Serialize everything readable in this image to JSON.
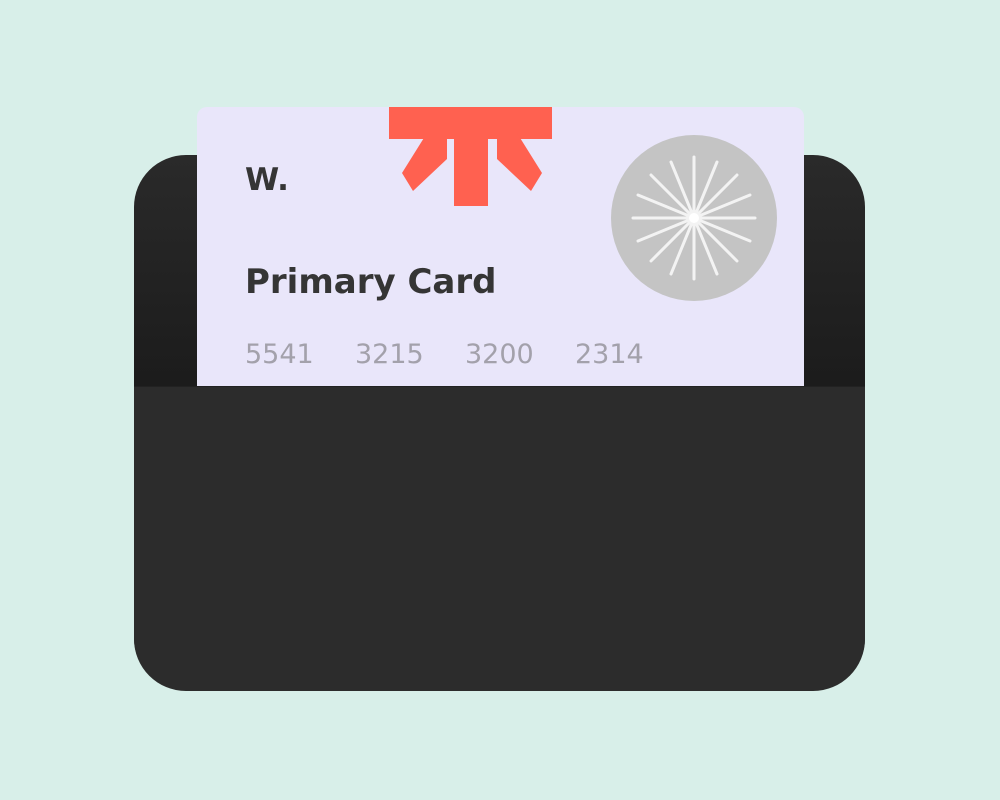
{
  "card": {
    "brand": "W.",
    "title": "Primary Card",
    "number_groups": [
      "5541",
      "3215",
      "3200",
      "2314"
    ]
  },
  "icons": {
    "burst": "asterisk-burst-icon",
    "emblem": "starburst-emblem-icon"
  },
  "colors": {
    "background": "#d8efe9",
    "wallet": "#2c2c2c",
    "card": "#e9e6fa",
    "accent": "#ff6150",
    "text_dark": "#353535",
    "text_muted": "#a3a1ab",
    "emblem": "#c4c4c4"
  }
}
